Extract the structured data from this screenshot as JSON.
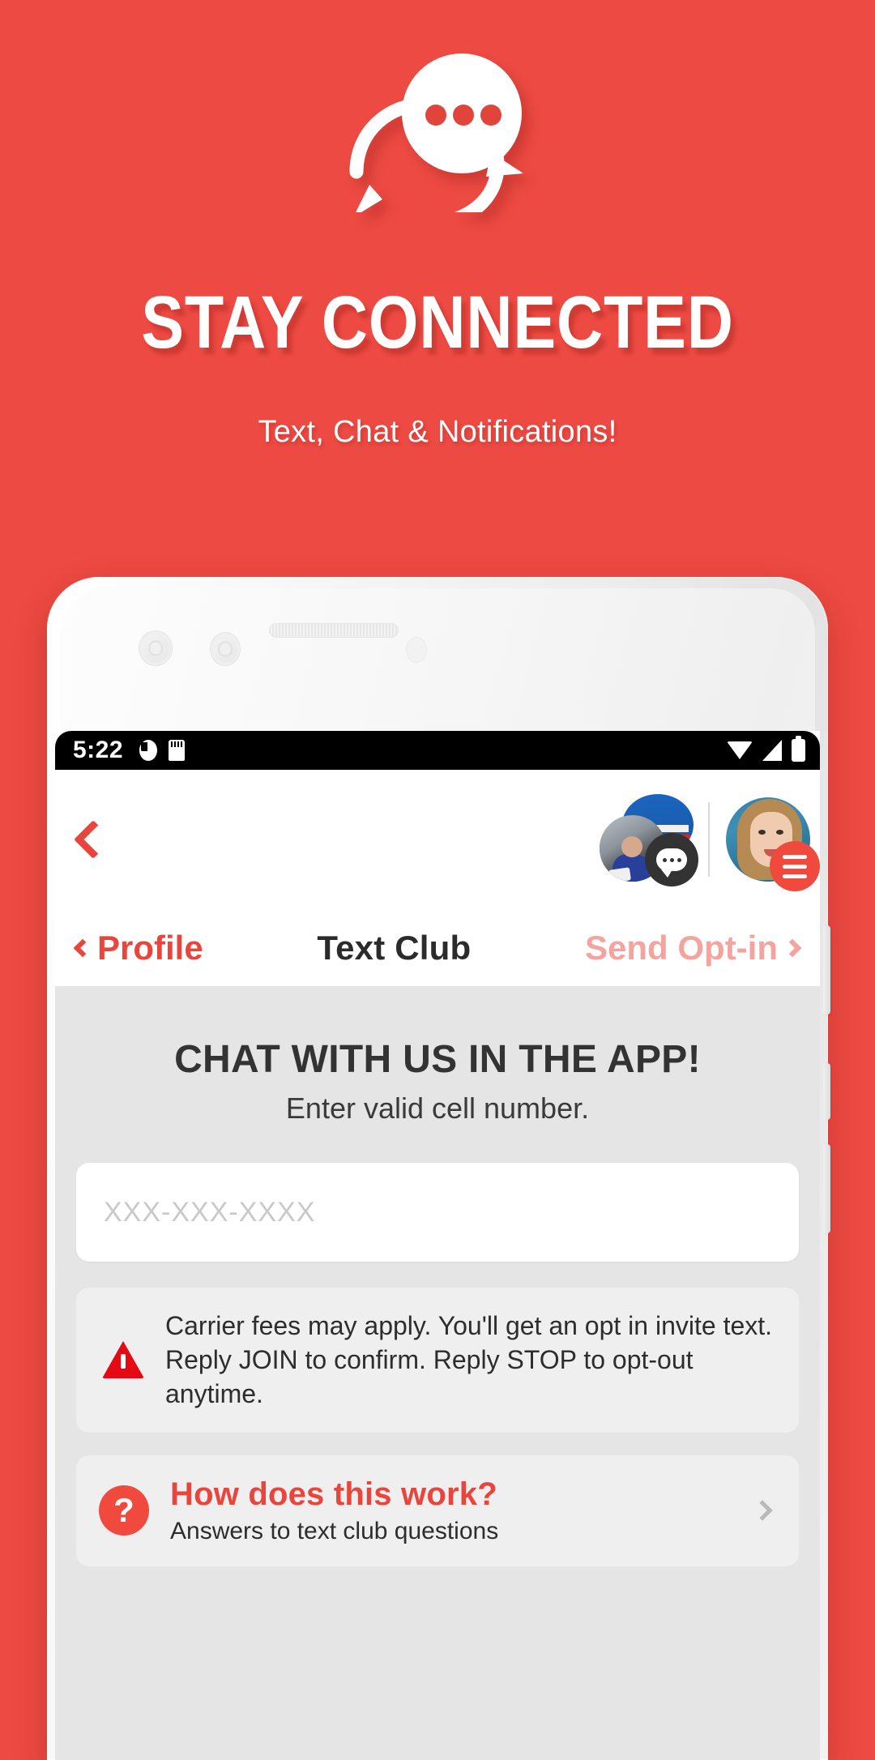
{
  "hero": {
    "headline": "STAY CONNECTED",
    "subhead": "Text, Chat & Notifications!",
    "background_color": "#EC4A42",
    "icon": "chat-bubbles-icon"
  },
  "phone": {
    "status_bar": {
      "time": "5:22",
      "left_icons": [
        "do-not-disturb-icon",
        "sd-card-icon"
      ],
      "right_icons": [
        "wifi-icon",
        "signal-icon",
        "battery-icon"
      ]
    },
    "app_bar": {
      "back_icon": "back-chevron-icon",
      "business_avatar": "business-avatar",
      "chat_badge_icon": "chat-bubble-icon",
      "user_avatar": "user-avatar",
      "menu_icon": "hamburger-menu-icon"
    },
    "nav_bar": {
      "left_label": "Profile",
      "title": "Text Club",
      "right_label": "Send Opt-in",
      "left_color": "#E8453C",
      "right_color": "#F3A49E",
      "title_color": "#2B2B2B"
    },
    "content": {
      "title": "CHAT WITH US IN THE APP!",
      "subtitle": "Enter valid cell number.",
      "phone_input_placeholder": "XXX-XXX-XXXX",
      "phone_input_value": "",
      "notice": {
        "icon": "warning-triangle-icon",
        "text": "Carrier fees may apply. You'll get an opt in invite text. Reply JOIN to confirm. Reply STOP to opt-out anytime.",
        "icon_color": "#E50914"
      },
      "faq": {
        "icon": "question-mark-icon",
        "title": "How does this work?",
        "subtitle": "Answers to text club questions",
        "chevron_icon": "chevron-right-icon",
        "accent_color": "#F04A3F"
      }
    }
  }
}
